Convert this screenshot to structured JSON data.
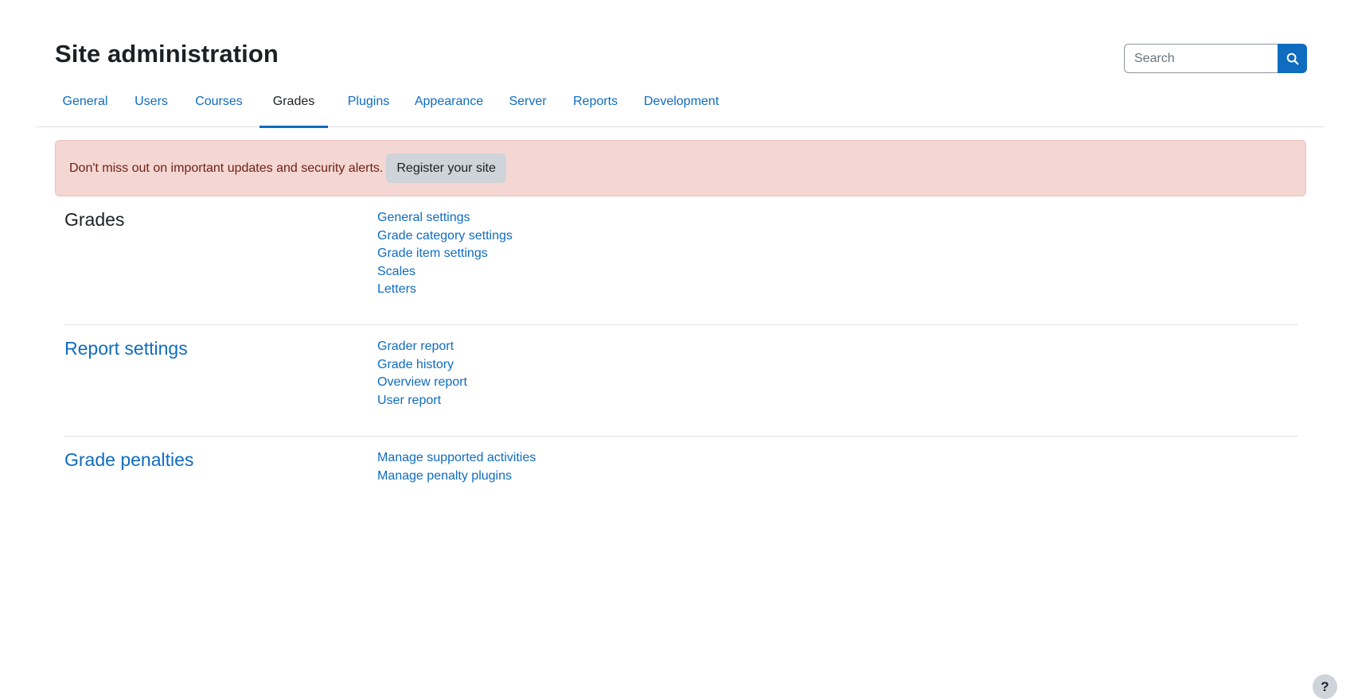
{
  "page": {
    "title": "Site administration"
  },
  "search": {
    "placeholder": "Search",
    "value": "",
    "icon": "search-icon"
  },
  "tabs": [
    {
      "label": "General",
      "active": false
    },
    {
      "label": "Users",
      "active": false
    },
    {
      "label": "Courses",
      "active": false
    },
    {
      "label": "Grades",
      "active": true
    },
    {
      "label": "Plugins",
      "active": false
    },
    {
      "label": "Appearance",
      "active": false
    },
    {
      "label": "Server",
      "active": false
    },
    {
      "label": "Reports",
      "active": false
    },
    {
      "label": "Development",
      "active": false
    }
  ],
  "alert": {
    "text": "Don't miss out on important updates and security alerts.",
    "button_label": "Register your site"
  },
  "sections": [
    {
      "title": "Grades",
      "title_is_link": false,
      "links": [
        "General settings",
        "Grade category settings",
        "Grade item settings",
        "Scales",
        "Letters"
      ]
    },
    {
      "title": "Report settings",
      "title_is_link": true,
      "links": [
        "Grader report",
        "Grade history",
        "Overview report",
        "User report"
      ]
    },
    {
      "title": "Grade penalties",
      "title_is_link": true,
      "links": [
        "Manage supported activities",
        "Manage penalty plugins"
      ]
    }
  ],
  "help": {
    "label": "?"
  },
  "colors": {
    "accent": "#0f6cbf",
    "text": "#1d2125",
    "alert_bg": "#f4d6d2",
    "alert_text": "#6e211a",
    "button_bg": "#ced4da"
  }
}
